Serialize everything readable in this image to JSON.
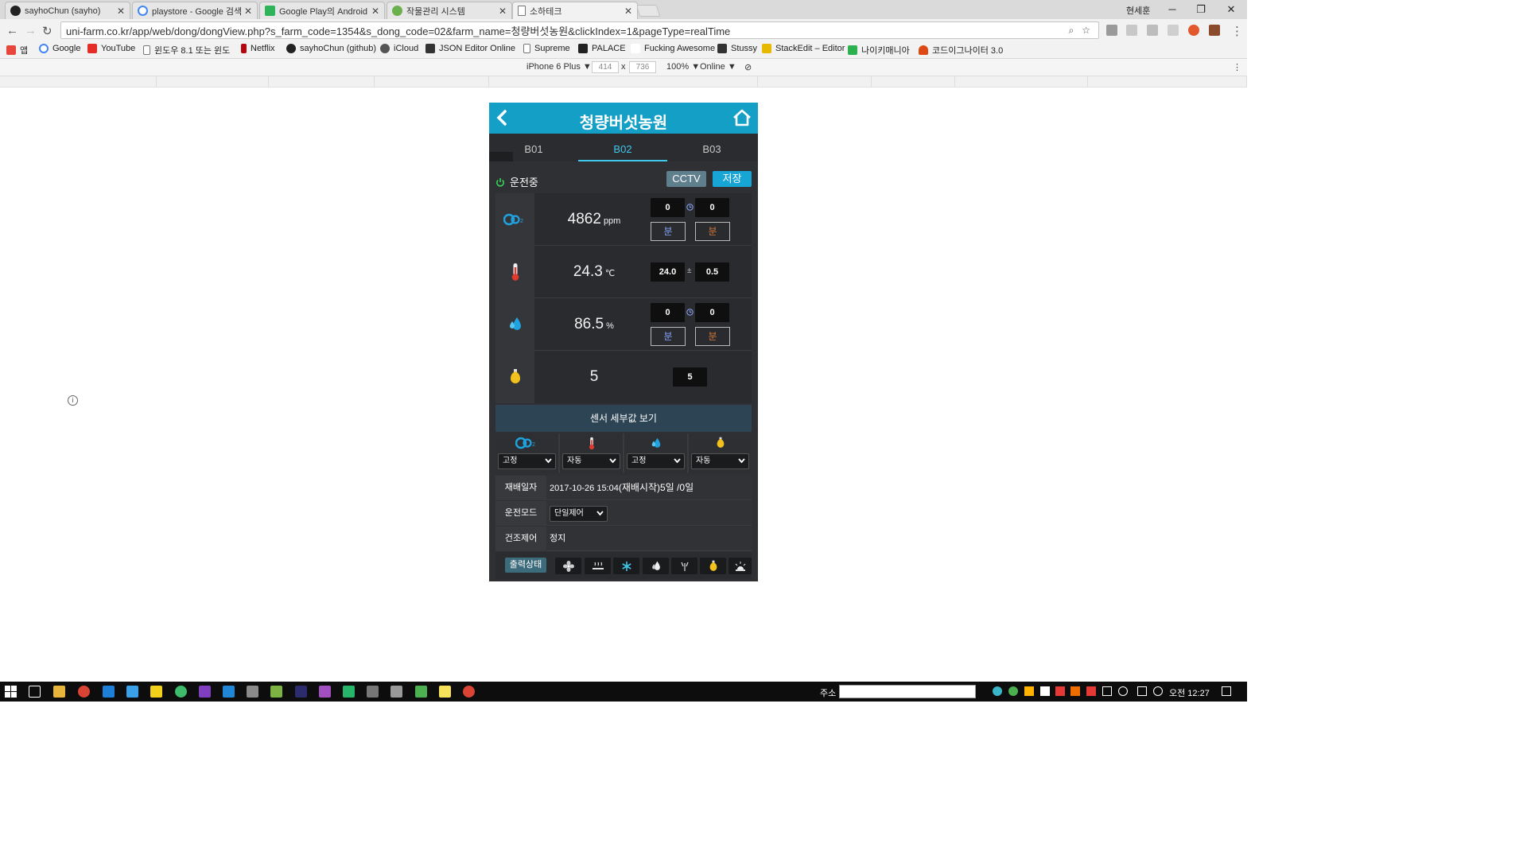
{
  "browser": {
    "tabs": [
      {
        "label": "sayhoChun (sayho)",
        "icon": "github-icon",
        "color": "#222222"
      },
      {
        "label": "playstore - Google 검색",
        "icon": "google-icon",
        "color": "#4285f4"
      },
      {
        "label": "Google Play의 Android",
        "icon": "google-play-icon",
        "color": "#2fb45a"
      },
      {
        "label": "작물관리 시스템",
        "icon": "leaf-icon",
        "color": "#6ab04c"
      },
      {
        "label": "소하테크",
        "icon": "page-icon",
        "color": "#888888"
      }
    ],
    "user": "현세훈",
    "url": "uni-farm.co.kr/app/web/dong/dongView.php?s_farm_code=1354&s_dong_code=02&farm_name=청량버섯농원&clickIndex=1&pageType=realTime",
    "bookmarks": [
      {
        "label": "앱",
        "color": "#e8453c"
      },
      {
        "label": "Google",
        "color": "#4285f4"
      },
      {
        "label": "YouTube",
        "color": "#e52d27"
      },
      {
        "label": "윈도우 8.1 또는 윈도",
        "color": "#888888"
      },
      {
        "label": "Netflix",
        "color": "#b20710"
      },
      {
        "label": "sayhoChun (github)",
        "color": "#222222"
      },
      {
        "label": "iCloud",
        "color": "#555555"
      },
      {
        "label": "JSON Editor Online",
        "color": "#333333"
      },
      {
        "label": "Supreme",
        "color": "#888888"
      },
      {
        "label": "PALACE",
        "color": "#222222"
      },
      {
        "label": "Fucking Awesome",
        "color": "#ffffff"
      },
      {
        "label": "Stussy",
        "color": "#333333"
      },
      {
        "label": "StackEdit – Editor",
        "color": "#e6b800"
      },
      {
        "label": "나이키매니아",
        "color": "#2bb24c"
      },
      {
        "label": "코드이그나이터 3.0",
        "color": "#dd4814"
      }
    ],
    "device": {
      "name": "iPhone 6 Plus ▼",
      "width": "414",
      "times": "x",
      "height": "736",
      "zoom": "100% ▼",
      "network": "Online ▼"
    }
  },
  "app": {
    "title": "청량버섯농원",
    "tabs": [
      "B01",
      "B02",
      "B03"
    ],
    "active_tab": "B02",
    "status": "운전중",
    "cctv_label": "CCTV",
    "save_label": "저장",
    "sensors": {
      "co2": {
        "value": "4862",
        "unit": "ppm",
        "set_a": "0",
        "set_b": "0",
        "min_a": "분",
        "min_b": "분"
      },
      "temp": {
        "value": "24.3",
        "unit": "℃",
        "set": "24.0",
        "sep": "±",
        "dev": "0.5"
      },
      "humidity": {
        "value": "86.5",
        "unit": "%",
        "set_a": "0",
        "set_b": "0",
        "min_a": "분",
        "min_b": "분"
      },
      "light": {
        "value": "5",
        "set": "5"
      }
    },
    "detail_label": "센서 세부값 보기",
    "modes": [
      "고정",
      "자동",
      "고정",
      "자동"
    ],
    "info": {
      "cultivation_label": "재배일자",
      "cultivation_date": "2017-10-26 15:04",
      "cultivation_note": "(재배시작)5일 /0일",
      "mode_label": "운전모드",
      "mode_value": "단일제어",
      "drying_label": "건조제어",
      "drying_value": "정지",
      "output_label": "출력상태"
    },
    "colors": {
      "header": "#139fc6",
      "accent": "#3fc7ec",
      "background": "#2f3033"
    }
  },
  "taskbar": {
    "address_label": "주소",
    "clock": "오전 12:27"
  }
}
